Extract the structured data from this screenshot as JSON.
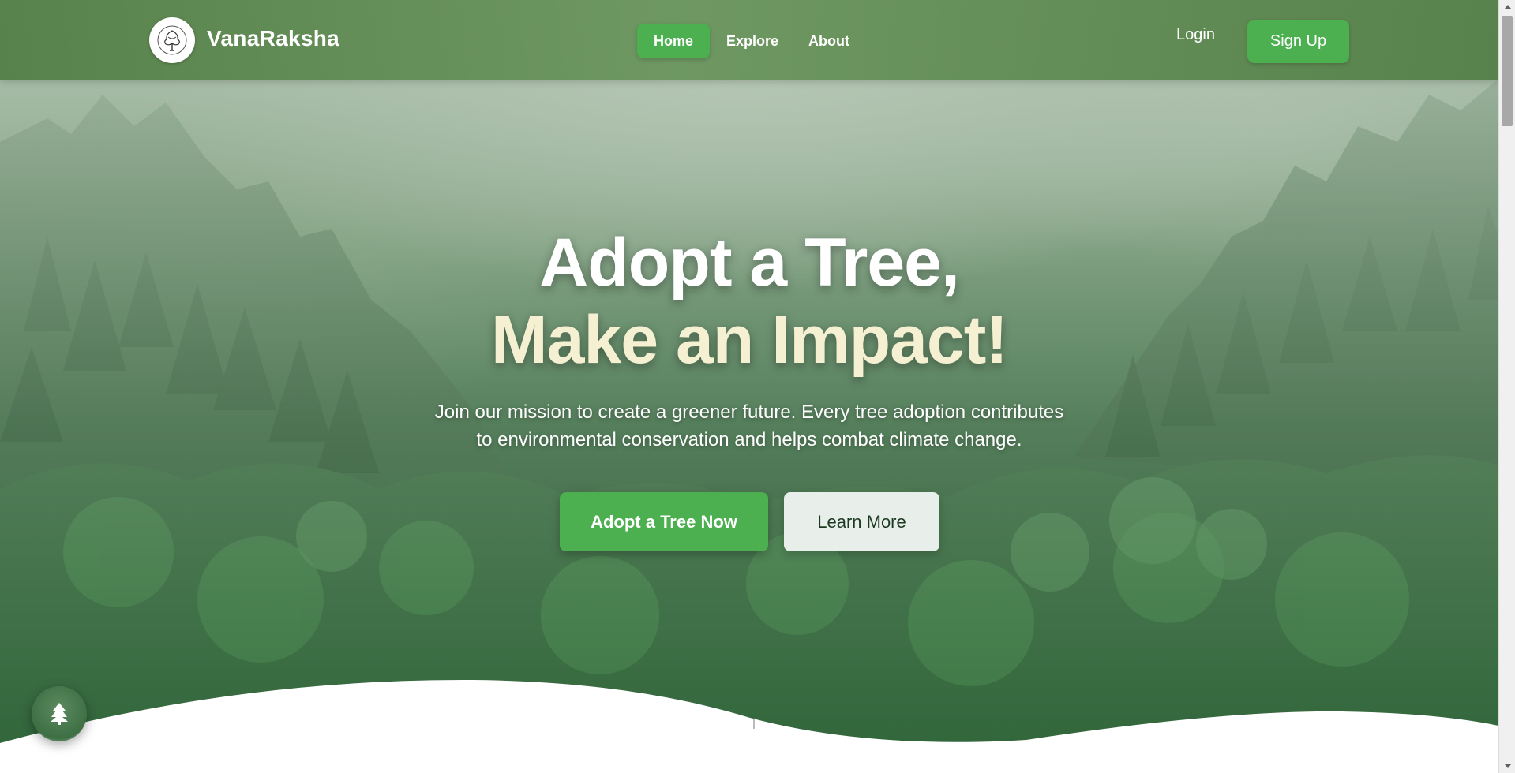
{
  "colors": {
    "nav_bg": "#6a9a5e",
    "accent": "#4caf50",
    "headline_white": "#ffffff",
    "headline_cream": "#f5f0d2",
    "secondary_button_bg": "#e8eee9"
  },
  "header": {
    "logo_icon": "tree-emblem-icon",
    "brand": "VanaRaksha",
    "nav": [
      {
        "label": "Home",
        "active": true
      },
      {
        "label": "Explore",
        "active": false
      },
      {
        "label": "About",
        "active": false
      }
    ],
    "login_label": "Login",
    "signup_label": "Sign Up"
  },
  "hero": {
    "headline_line1": "Adopt a Tree,",
    "headline_line2": "Make an Impact!",
    "subtitle_line1": "Join our mission to create a greener future. Every tree adoption contributes",
    "subtitle_line2": "to environmental conservation and helps combat climate change.",
    "primary_button": "Adopt a Tree Now",
    "secondary_button": "Learn More"
  },
  "floating_button": {
    "icon": "tree-icon"
  }
}
